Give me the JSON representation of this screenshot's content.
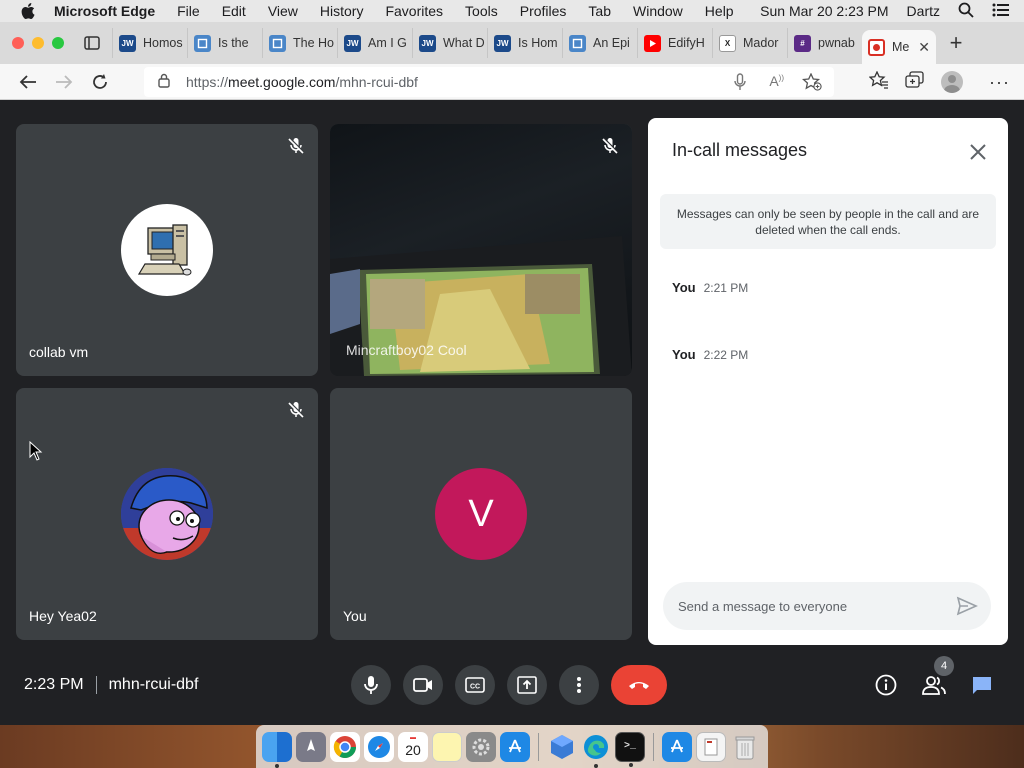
{
  "menubar": {
    "app_name": "Microsoft Edge",
    "items": [
      "File",
      "Edit",
      "View",
      "History",
      "Favorites",
      "Tools",
      "Profiles",
      "Tab",
      "Window",
      "Help"
    ],
    "clock": "Sun Mar 20  2:23 PM",
    "user": "Dartz",
    "icons": [
      "apple-icon",
      "search-icon",
      "control-center-icon"
    ]
  },
  "tabs": [
    {
      "label": "Homos",
      "favicon": "JW",
      "color": "#1c4a8a"
    },
    {
      "label": "Is the",
      "favicon": "doc",
      "color": "#4a86c8"
    },
    {
      "label": "The Ho",
      "favicon": "doc",
      "color": "#4a86c8"
    },
    {
      "label": "Am I G",
      "favicon": "JW",
      "color": "#1c4a8a"
    },
    {
      "label": "What D",
      "favicon": "JW",
      "color": "#1c4a8a"
    },
    {
      "label": "Is Hom",
      "favicon": "JW",
      "color": "#1c4a8a"
    },
    {
      "label": "An Epi",
      "favicon": "doc",
      "color": "#4a86c8"
    },
    {
      "label": "EdifyH",
      "favicon": "yt",
      "color": "#ff0000"
    },
    {
      "label": "Mador",
      "favicon": "X",
      "color": "#222222"
    },
    {
      "label": "pwnab",
      "favicon": "#",
      "color": "#5b2a86"
    },
    {
      "label": "Me",
      "favicon": "rec",
      "color": "#d93025",
      "active": true
    }
  ],
  "address": {
    "url_prefix": "https://",
    "url_host": "meet.google.com",
    "url_path": "/mhn-rcui-dbf"
  },
  "participants": [
    {
      "name": "collab vm",
      "muted": true,
      "avatar": "computer"
    },
    {
      "name": "Mincraftboy02 Cool",
      "muted": true,
      "avatar": "video"
    },
    {
      "name": "Hey Yea02",
      "muted": true,
      "avatar": "cartoon"
    },
    {
      "name": "You",
      "muted": false,
      "avatar": "letter",
      "initial": "V",
      "color": "#c2185b"
    }
  ],
  "chat": {
    "title": "In-call messages",
    "notice": "Messages can only be seen by people in the call and are deleted when the call ends.",
    "messages": [
      {
        "sender": "You",
        "time": "2:21 PM",
        "body": ""
      },
      {
        "sender": "You",
        "time": "2:22 PM",
        "body": ""
      }
    ],
    "input_placeholder": "Send a message to everyone"
  },
  "bottom": {
    "time": "2:23 PM",
    "meeting_code": "mhn-rcui-dbf",
    "people_count": "4"
  },
  "colors": {
    "meet_bg": "#202124",
    "tile_bg": "#3c4043",
    "end_call": "#ea4335",
    "chat_active": "#8ab4f8"
  }
}
